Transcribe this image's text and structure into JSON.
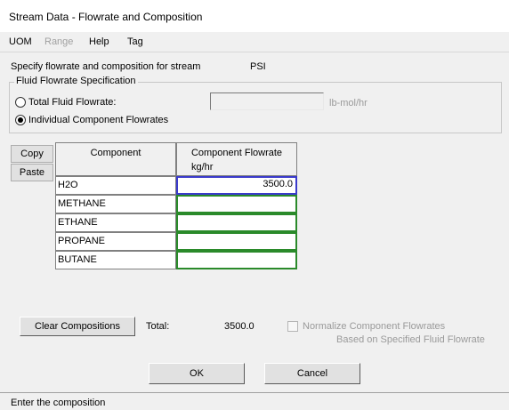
{
  "window": {
    "title": "Stream Data - Flowrate and Composition"
  },
  "menu": {
    "uom": "UOM",
    "range": "Range",
    "help": "Help",
    "tag": "Tag"
  },
  "stream": {
    "prompt": "Specify flowrate and composition for stream",
    "name": "PSI"
  },
  "spec_group": {
    "label": "Fluid Flowrate Specification",
    "total_option": "Total Fluid Flowrate:",
    "total_value": "",
    "total_unit": "lb-mol/hr",
    "individual_option": "Individual Component Flowrates",
    "selected": "individual"
  },
  "grid": {
    "copy_label": "Copy",
    "paste_label": "Paste",
    "col_component": "Component",
    "col_flowrate": "Component Flowrate",
    "col_flowrate_unit": "kg/hr",
    "rows": [
      {
        "component": "H2O",
        "flowrate": "3500.0"
      },
      {
        "component": "METHANE",
        "flowrate": ""
      },
      {
        "component": "ETHANE",
        "flowrate": ""
      },
      {
        "component": "PROPANE",
        "flowrate": ""
      },
      {
        "component": "BUTANE",
        "flowrate": ""
      }
    ]
  },
  "footer": {
    "clear_label": "Clear Compositions",
    "total_label": "Total:",
    "total_value": "3500.0",
    "normalize_label": "Normalize Component Flowrates",
    "normalize_sub": "Based on Specified Fluid Flowrate",
    "normalize_checked": false
  },
  "buttons": {
    "ok": "OK",
    "cancel": "Cancel"
  },
  "status": {
    "text": "Enter the composition"
  },
  "colors": {
    "grid_border_green": "#2a8a2a",
    "selected_blue": "#3a3acb"
  }
}
